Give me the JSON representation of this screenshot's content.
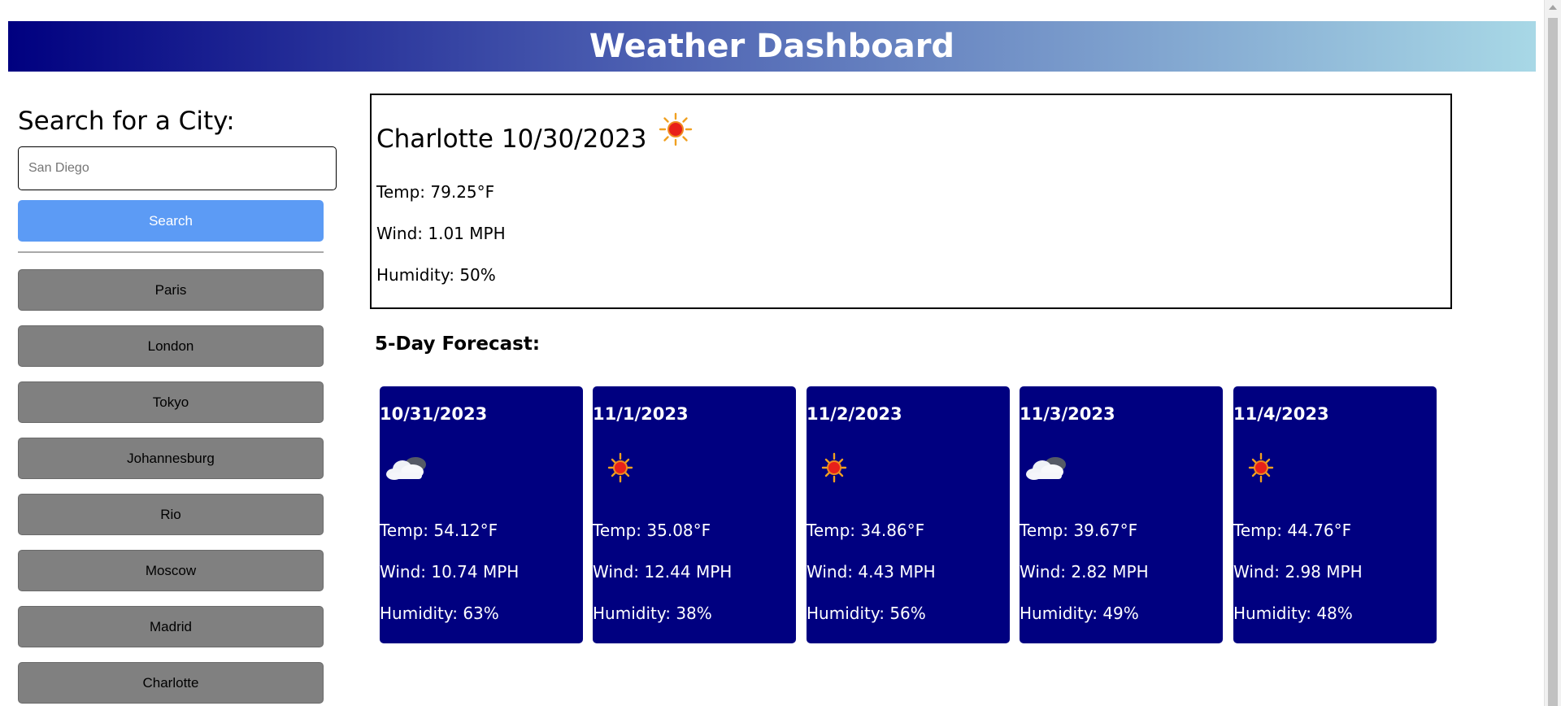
{
  "header": {
    "title": "Weather Dashboard"
  },
  "sidebar": {
    "heading": "Search for a City:",
    "search": {
      "placeholder": "San Diego",
      "value": ""
    },
    "search_button_label": "Search",
    "history": [
      "Paris",
      "London",
      "Tokyo",
      "Johannesburg",
      "Rio",
      "Moscow",
      "Madrid",
      "Charlotte"
    ]
  },
  "current": {
    "city": "Charlotte",
    "date": "10/30/2023",
    "heading": "Charlotte 10/30/2023",
    "icon": "sun-icon",
    "temp": "Temp: 79.25°F",
    "wind": "Wind: 1.01 MPH",
    "humidity": "Humidity: 50%"
  },
  "forecast": {
    "title": "5-Day Forecast:",
    "days": [
      {
        "date": "10/31/2023",
        "icon": "cloud-icon",
        "temp": "Temp: 54.12°F",
        "wind": "Wind: 10.74 MPH",
        "humidity": "Humidity: 63%"
      },
      {
        "date": "11/1/2023",
        "icon": "sun-icon",
        "temp": "Temp: 35.08°F",
        "wind": "Wind: 12.44 MPH",
        "humidity": "Humidity: 38%"
      },
      {
        "date": "11/2/2023",
        "icon": "sun-icon",
        "temp": "Temp: 34.86°F",
        "wind": "Wind: 4.43 MPH",
        "humidity": "Humidity: 56%"
      },
      {
        "date": "11/3/2023",
        "icon": "cloud-icon",
        "temp": "Temp: 39.67°F",
        "wind": "Wind: 2.82 MPH",
        "humidity": "Humidity: 49%"
      },
      {
        "date": "11/4/2023",
        "icon": "sun-icon",
        "temp": "Temp: 44.76°F",
        "wind": "Wind: 2.98 MPH",
        "humidity": "Humidity: 48%"
      }
    ]
  },
  "colors": {
    "header_start": "#000080",
    "header_end": "#a8d8e6",
    "search_button": "#5c9bf5",
    "history_button": "#808080",
    "forecast_card": "#000080"
  }
}
